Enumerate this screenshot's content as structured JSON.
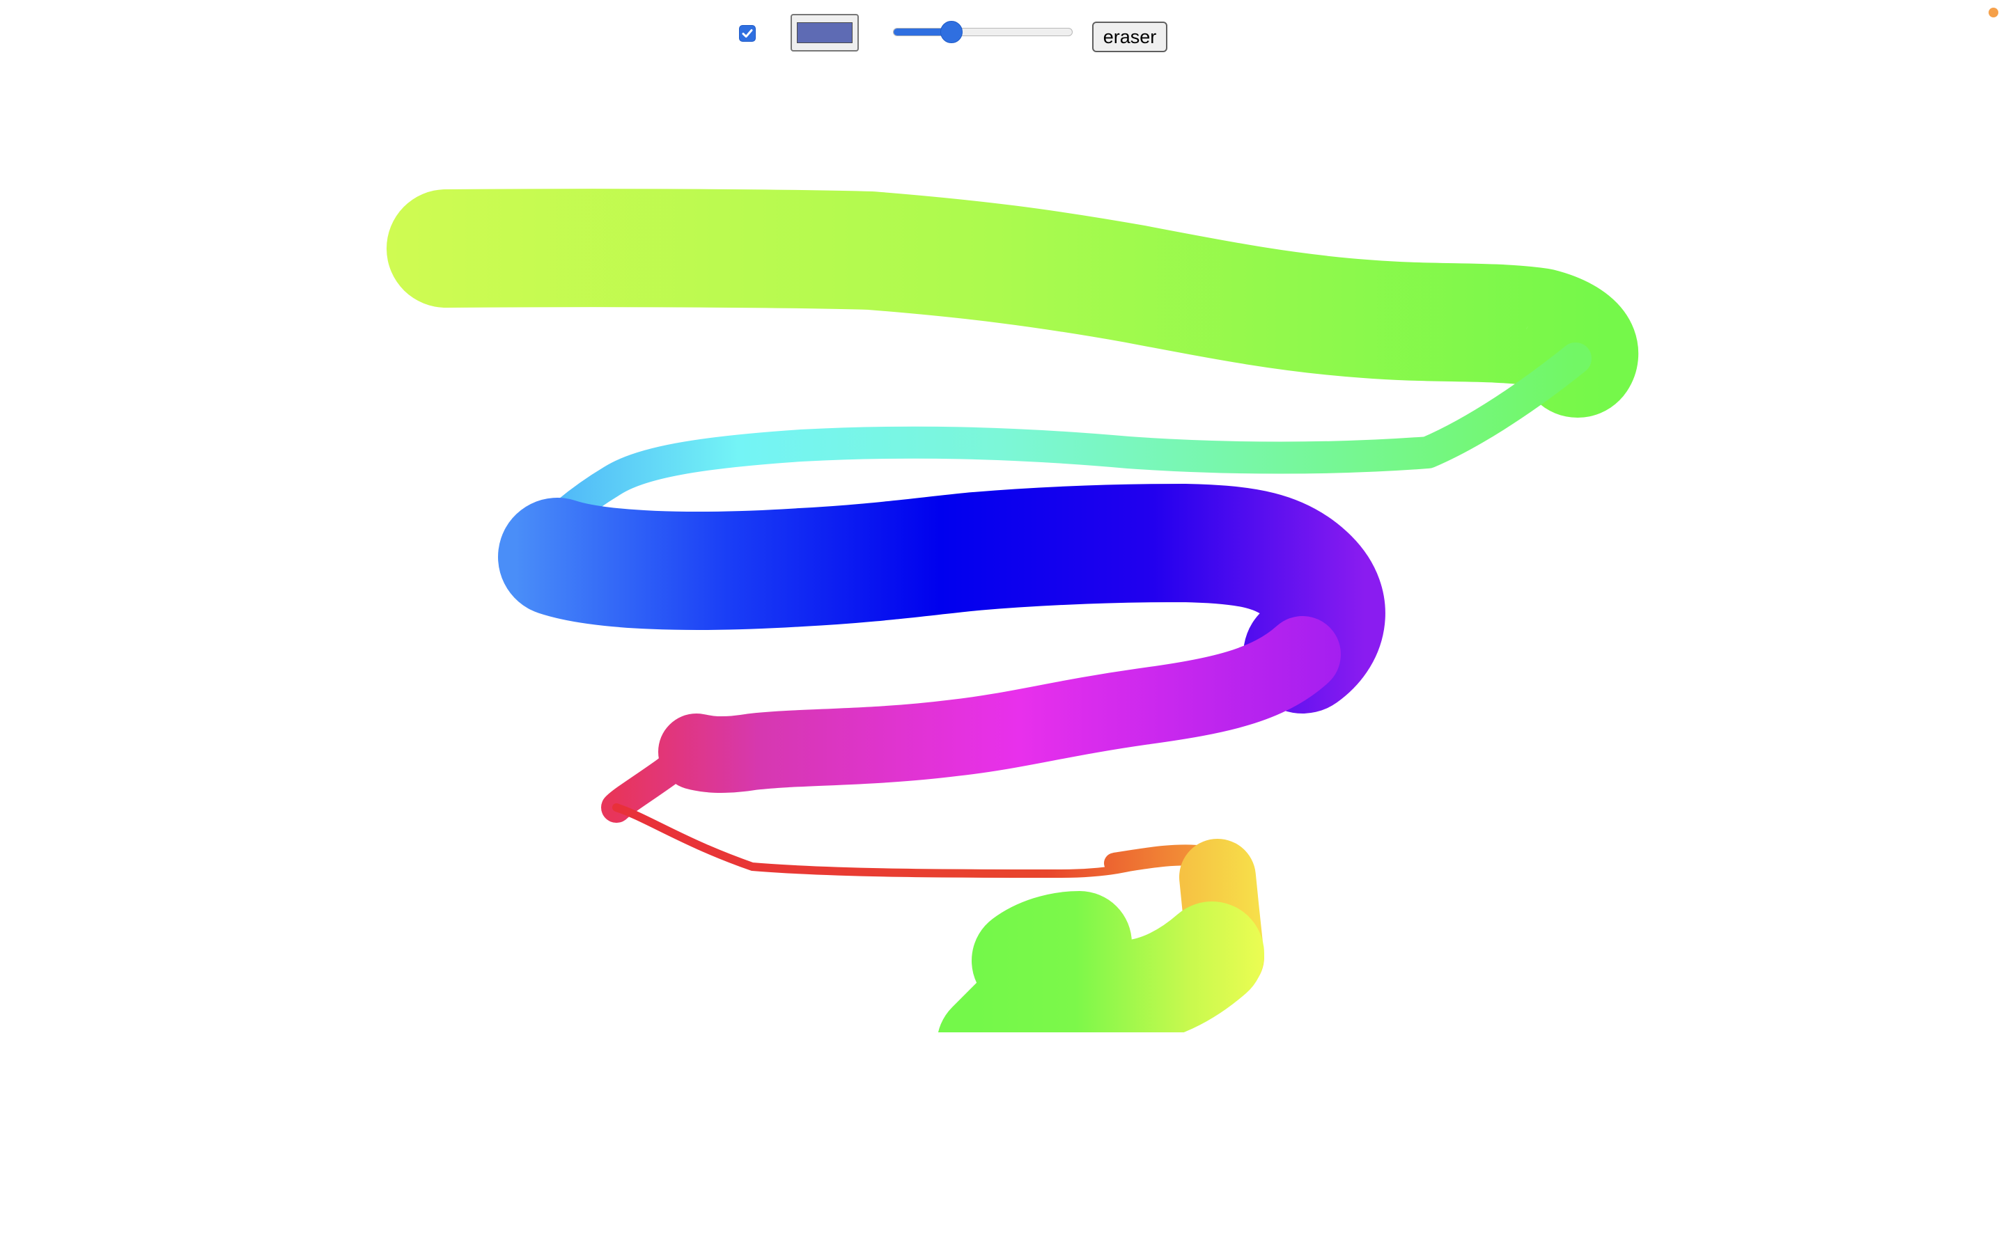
{
  "toolbar": {
    "rainbow_checkbox_checked": true,
    "color_value": "#5e6bb4",
    "size_slider_fraction": 0.3,
    "eraser_label": "eraser"
  },
  "colors": {
    "accent": "#2f6fe0",
    "indicator_dot": "#f5a04a",
    "background": "#ffffff"
  },
  "canvas": {
    "stroke_description_colors": [
      "#cdfa52",
      "#a8fa4c",
      "#78f84a",
      "#74f5f2",
      "#0000ee",
      "#6412f0",
      "#e832e8",
      "#e8355f",
      "#e84d2c",
      "#f6d948",
      "#76f84b"
    ]
  }
}
